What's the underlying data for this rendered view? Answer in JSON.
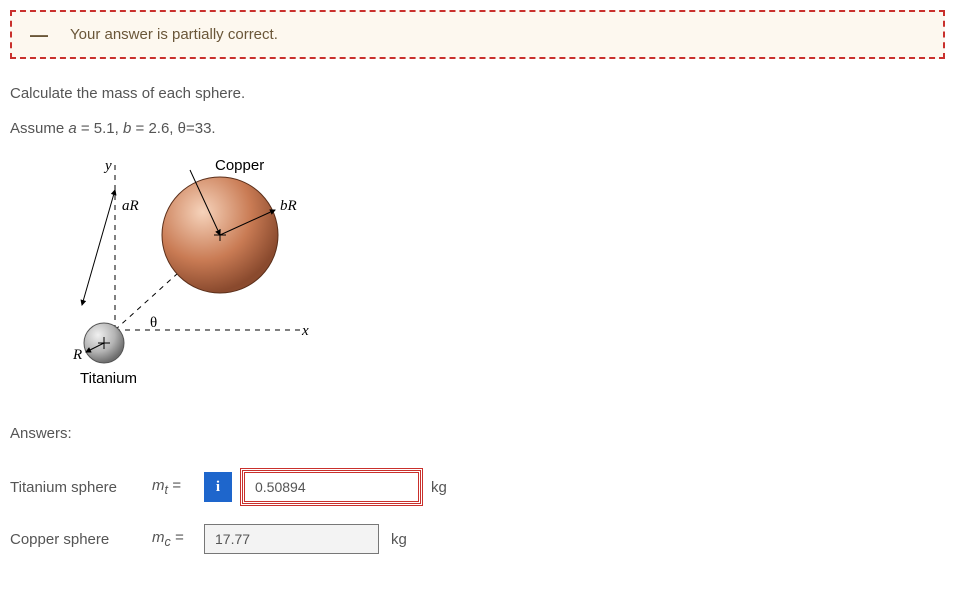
{
  "feedback": {
    "message": "Your answer is partially correct."
  },
  "problem": {
    "instruction": "Calculate the mass of each sphere.",
    "assumptions_prefix": "Assume ",
    "a_label": "a",
    "a_eq": " = 5.1, ",
    "b_label": "b",
    "b_eq": " = 2.6, θ=33."
  },
  "diagram": {
    "y_label": "y",
    "x_label": "x",
    "aR_label": "aR",
    "bR_label": "bR",
    "R_label": "R",
    "theta_label": "θ",
    "copper_label": "Copper",
    "titanium_label": "Titanium"
  },
  "answers": {
    "heading": "Answers:",
    "titanium": {
      "name": "Titanium sphere",
      "var_html": "m",
      "var_sub": "t",
      "eq": " =",
      "value": "0.50894",
      "unit": "kg",
      "info_glyph": "i"
    },
    "copper": {
      "name": "Copper sphere",
      "var_html": "m",
      "var_sub": "c",
      "eq": " =",
      "value": "17.77",
      "unit": "kg"
    }
  }
}
